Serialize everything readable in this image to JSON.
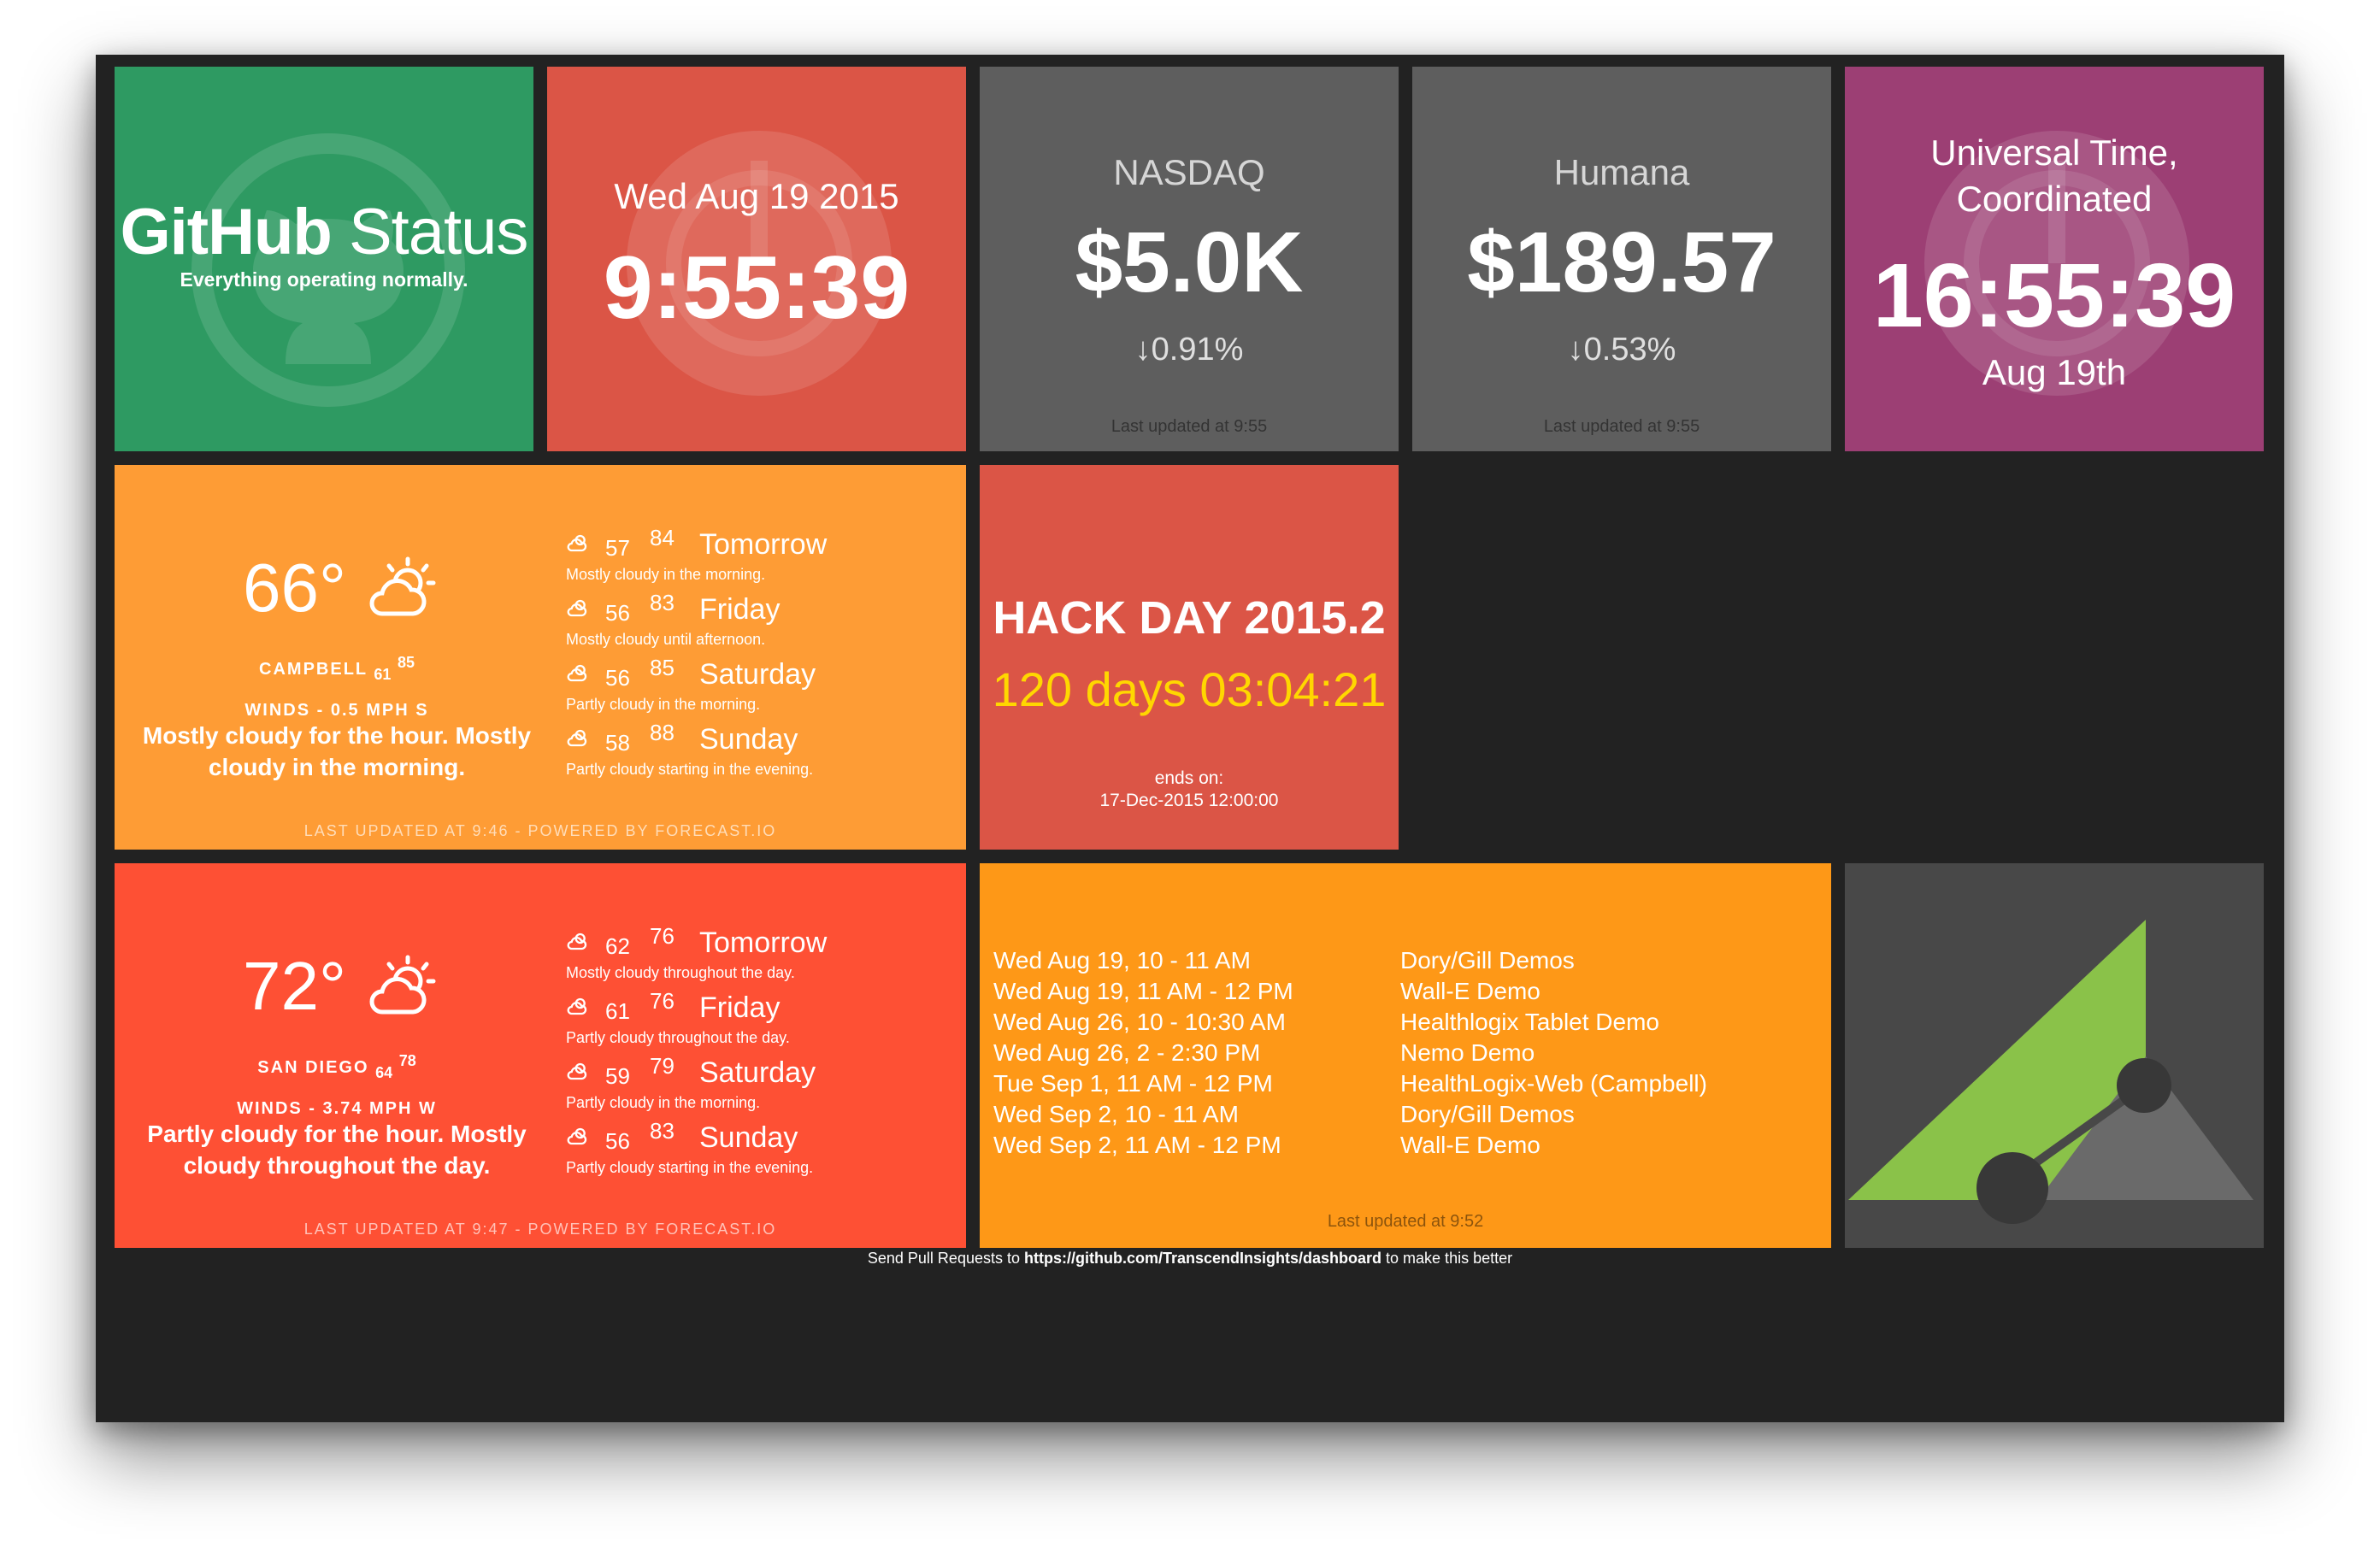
{
  "github": {
    "title_bold": "GitHub",
    "title_light": " Status",
    "status": "Everything operating normally.",
    "color": "#2e9a62"
  },
  "clock": {
    "date": "Wed Aug 19 2015",
    "time": "9:55:39",
    "color": "#db5546"
  },
  "stocks": [
    {
      "name": "NASDAQ",
      "value": "$5.0K",
      "change": "↓0.91%",
      "updated": "Last updated at 9:55"
    },
    {
      "name": "Humana",
      "value": "$189.57",
      "change": "↓0.53%",
      "updated": "Last updated at 9:55"
    }
  ],
  "utc": {
    "title_line1": "Universal Time,",
    "title_line2": "Coordinated",
    "time": "16:55:39",
    "date": "Aug 19th",
    "color": "#9c3f74"
  },
  "weather": [
    {
      "temp": "66°",
      "city": "CAMPBELL",
      "low": "61",
      "high": "85",
      "winds": "WINDS - 0.5 MPH S",
      "summary": "Mostly cloudy for the hour. Mostly cloudy in the morning.",
      "forecast": [
        {
          "low": "57",
          "high": "84",
          "day": "Tomorrow",
          "desc": "Mostly cloudy in the morning."
        },
        {
          "low": "56",
          "high": "83",
          "day": "Friday",
          "desc": "Mostly cloudy until afternoon."
        },
        {
          "low": "56",
          "high": "85",
          "day": "Saturday",
          "desc": "Partly cloudy in the morning."
        },
        {
          "low": "58",
          "high": "88",
          "day": "Sunday",
          "desc": "Partly cloudy starting in the evening."
        }
      ],
      "footer": "LAST UPDATED AT 9:46 - POWERED BY FORECAST.IO",
      "color": "#fe9c35"
    },
    {
      "temp": "72°",
      "city": "SAN DIEGO",
      "low": "64",
      "high": "78",
      "winds": "WINDS - 3.74 MPH W",
      "summary": "Partly cloudy for the hour. Mostly cloudy throughout the day.",
      "forecast": [
        {
          "low": "62",
          "high": "76",
          "day": "Tomorrow",
          "desc": "Mostly cloudy throughout the day."
        },
        {
          "low": "61",
          "high": "76",
          "day": "Friday",
          "desc": "Partly cloudy throughout the day."
        },
        {
          "low": "59",
          "high": "79",
          "day": "Saturday",
          "desc": "Partly cloudy in the morning."
        },
        {
          "low": "56",
          "high": "83",
          "day": "Sunday",
          "desc": "Partly cloudy starting in the evening."
        }
      ],
      "footer": "LAST UPDATED AT 9:47 - POWERED BY FORECAST.IO",
      "color": "#fe5034"
    }
  ],
  "hackday": {
    "title": "HACK DAY 2015.2",
    "countdown": "120 days 03:04:21",
    "ends_label": "ends on:",
    "ends_date": "17-Dec-2015 12:00:00"
  },
  "calendar": {
    "events": [
      {
        "time": "Wed Aug 19, 10 - 11 AM",
        "title": "Dory/Gill Demos"
      },
      {
        "time": "Wed Aug 19, 11 AM - 12 PM",
        "title": "Wall-E Demo"
      },
      {
        "time": "Wed Aug 26, 10 - 10:30 AM",
        "title": "Healthlogix Tablet Demo"
      },
      {
        "time": "Wed Aug 26, 2 - 2:30 PM",
        "title": "Nemo Demo"
      },
      {
        "time": "Tue Sep 1, 11 AM - 12 PM",
        "title": "HealthLogix-Web (Campbell)"
      },
      {
        "time": "Wed Sep 2, 10 - 11 AM",
        "title": "Dory/Gill Demos"
      },
      {
        "time": "Wed Sep 2, 11 AM - 12 PM",
        "title": "Wall-E Demo"
      }
    ],
    "updated": "Last updated at 9:52",
    "color": "#fe9817"
  },
  "footer": {
    "prefix": "Send Pull Requests to ",
    "link": "https://github.com/TranscendInsights/dashboard",
    "suffix": " to make this better"
  }
}
